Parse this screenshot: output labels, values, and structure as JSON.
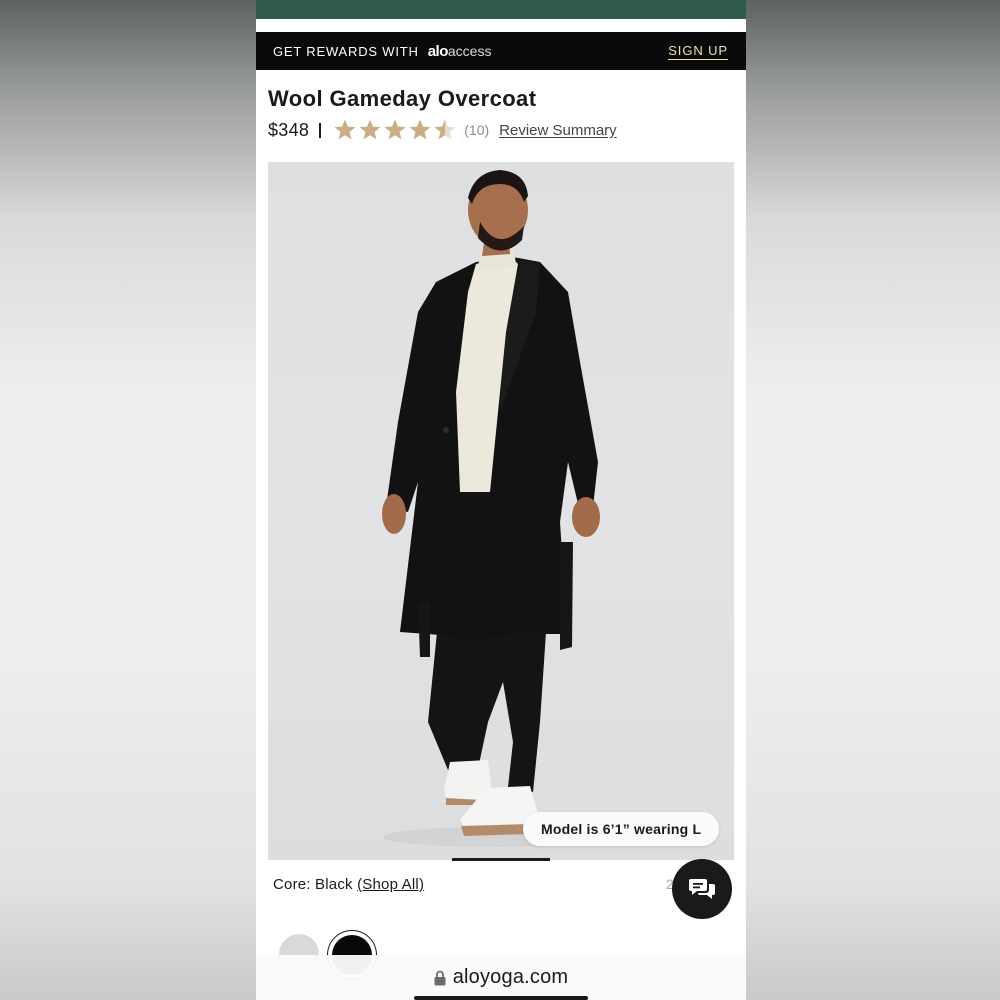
{
  "rewards_bar": {
    "text": "GET REWARDS WITH",
    "logo_bold": "alo",
    "logo_light": "access",
    "signup_label": "SIGN UP"
  },
  "product": {
    "title": "Wool Gameday Overcoat",
    "price": "$348",
    "rating": 4.5,
    "rating_max": 5,
    "review_count": "(10)",
    "review_summary_label": "Review Summary",
    "model_info": "Model is 6’1” wearing L",
    "image_index": 1,
    "image_total": 5
  },
  "color": {
    "prefix": "Core: Black",
    "shop_all_label": "(Shop All)",
    "selected": "Black",
    "size_hint": "2",
    "swatches": [
      {
        "name": "grey",
        "color": "#d9d9d9"
      },
      {
        "name": "black",
        "color": "#0a0a0a"
      }
    ]
  },
  "browser": {
    "url": "aloyoga.com"
  },
  "colors": {
    "star": "#c9ad87",
    "star_empty": "#e7dccd",
    "header_green": "#2f5a4d",
    "signup": "#e9e3b5"
  }
}
